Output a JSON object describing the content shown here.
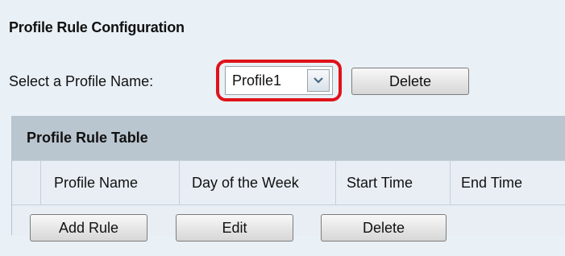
{
  "config": {
    "title": "Profile Rule Configuration",
    "select_label": "Select a Profile Name:",
    "selected_profile": "Profile1",
    "delete_label": "Delete",
    "highlight_color": "#e01219"
  },
  "table": {
    "title": "Profile Rule Table",
    "columns": [
      "Profile Name",
      "Day of the Week",
      "Start Time",
      "End Time"
    ]
  },
  "actions": {
    "add_rule": "Add Rule",
    "edit": "Edit",
    "delete": "Delete"
  },
  "icons": {
    "dropdown": "chevron-down-icon"
  }
}
